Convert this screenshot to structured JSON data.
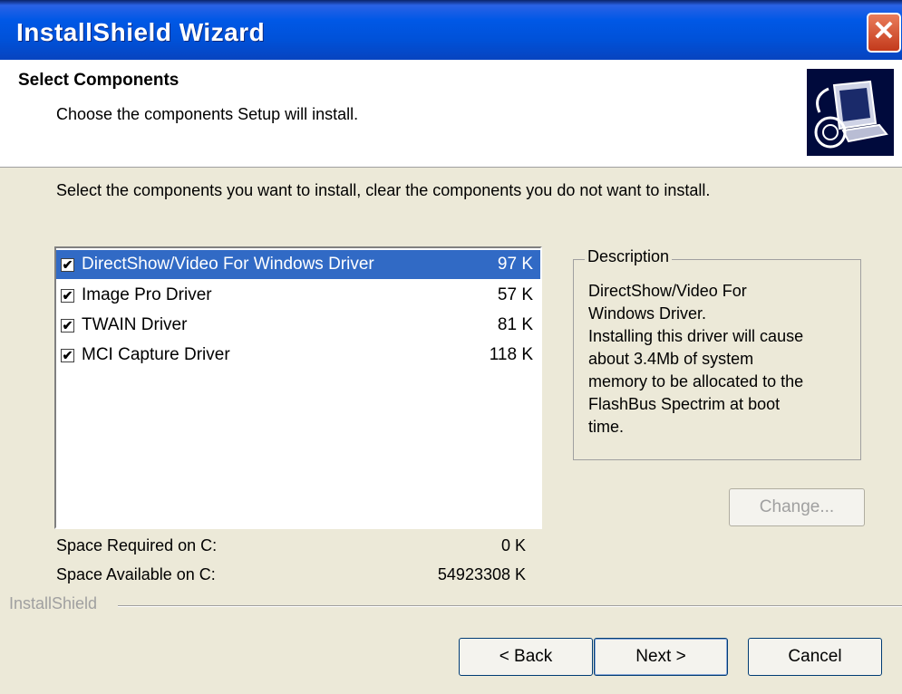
{
  "window": {
    "title": "InstallShield Wizard",
    "close_symbol": "✕"
  },
  "header": {
    "title": "Select Components",
    "subtitle": "Choose the components Setup will install.",
    "icon": "computer-setup-icon"
  },
  "instruction": "Select the components you want to install, clear the components you do not want to install.",
  "components": [
    {
      "name": "DirectShow/Video For Windows Driver",
      "size": "97 K",
      "checked": true,
      "selected": true
    },
    {
      "name": "Image Pro Driver",
      "size": "57 K",
      "checked": true,
      "selected": false
    },
    {
      "name": "TWAIN Driver",
      "size": "81 K",
      "checked": true,
      "selected": false
    },
    {
      "name": "MCI Capture Driver",
      "size": "118 K",
      "checked": true,
      "selected": false
    }
  ],
  "space": {
    "required_label": "Space Required on  C:",
    "required_value": "0 K",
    "available_label": "Space Available on  C:",
    "available_value": "54923308 K"
  },
  "description": {
    "legend": "Description",
    "text": "DirectShow/Video For\nWindows Driver.\nInstalling this driver will cause\nabout 3.4Mb of system\nmemory to be allocated to the\nFlashBus Spectrim at boot\ntime."
  },
  "buttons": {
    "change": "Change...",
    "back": "< Back",
    "next": "Next >",
    "cancel": "Cancel"
  },
  "footer_brand": "InstallShield",
  "colors": {
    "selection": "#316ac5",
    "titlebar": "#0058e6",
    "dialog": "#ece9d8"
  }
}
